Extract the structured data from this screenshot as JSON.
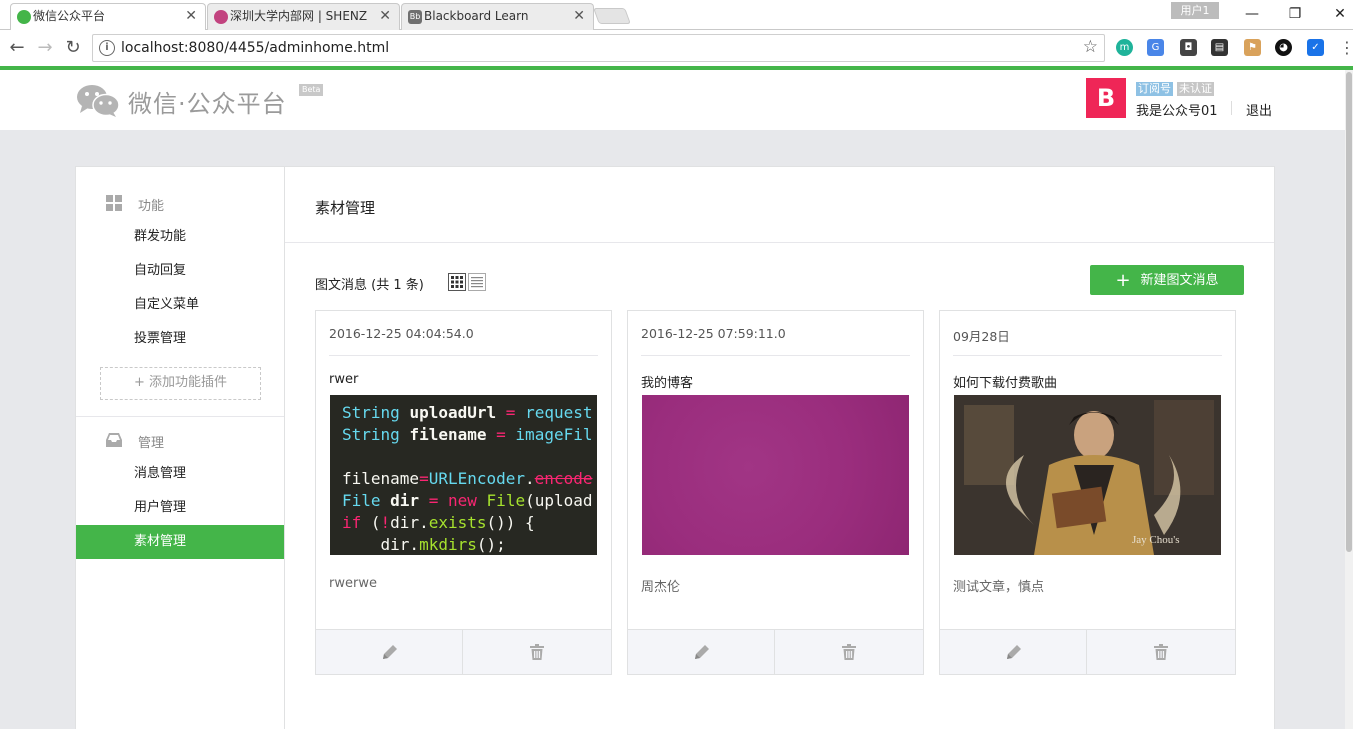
{
  "browser": {
    "tabs": [
      {
        "title": "微信公众平台",
        "favicon": "wechat-icon",
        "color": "#44b549"
      },
      {
        "title": "深圳大学内部网 | SHENZ",
        "favicon": "szu-icon",
        "color": "#c2437f"
      },
      {
        "title": "Blackboard Learn",
        "favicon": "bb-icon",
        "color": "#6f6f6f"
      }
    ],
    "user_chip": "用户1",
    "url": "localhost:8080/4455/adminhome.html",
    "extensions": [
      "m-icon",
      "translate-icon",
      "shield-icon",
      "film-icon",
      "tag-icon",
      "color-icon",
      "defender-icon"
    ]
  },
  "header": {
    "logo_text": "微信·公众平台",
    "beta": "Beta",
    "avatar_letter": "B",
    "badge_subscription": "订阅号",
    "badge_unverified": "未认证",
    "account_name": "我是公众号01",
    "logout": "退出"
  },
  "sidebar": {
    "section_function": {
      "label": "功能",
      "icon": "grid-icon"
    },
    "function_items": [
      "群发功能",
      "自动回复",
      "自定义菜单",
      "投票管理"
    ],
    "add_plugin": "+ 添加功能插件",
    "section_manage": {
      "label": "管理",
      "icon": "inbox-icon"
    },
    "manage_items": [
      "消息管理",
      "用户管理",
      "素材管理"
    ],
    "selected": "素材管理"
  },
  "main": {
    "title": "素材管理",
    "summary": "图文消息 (共 1 条)",
    "new_button": "新建图文消息",
    "cards": [
      {
        "date": "2016-12-25 04:04:54.0",
        "title": "rwer",
        "digest": "rwerwe",
        "thumb": "code-screenshot"
      },
      {
        "date": "2016-12-25 07:59:11.0",
        "title": "我的博客",
        "digest": "周杰伦",
        "thumb": "purple-cover"
      },
      {
        "date": "09月28日",
        "title": "如何下载付费歌曲",
        "digest": "测试文章，慎点",
        "thumb": "jay-chou-photo",
        "thumb_caption": "Jay Chou's"
      }
    ]
  },
  "colors": {
    "accent": "#44b549",
    "avatar": "#ef2657",
    "badge_sub": "#8ec1e4"
  }
}
